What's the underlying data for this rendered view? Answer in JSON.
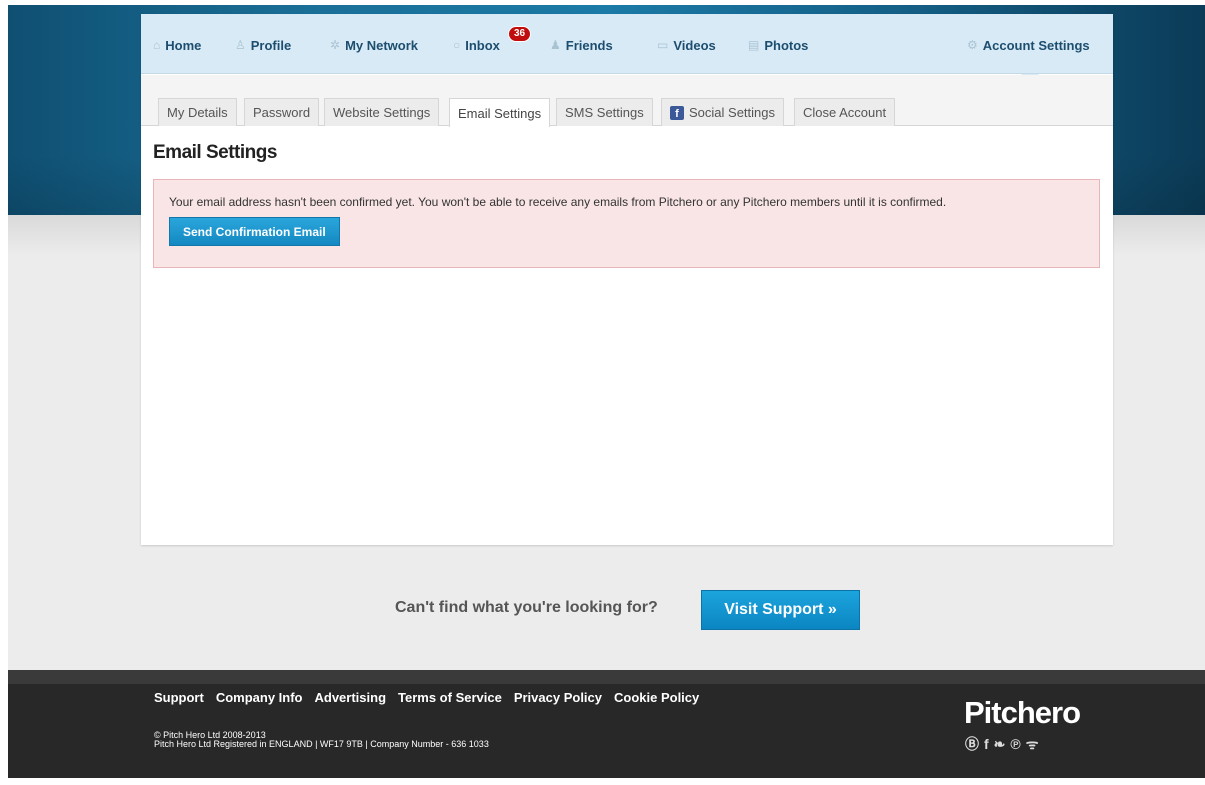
{
  "nav": {
    "items": [
      {
        "label": "Home",
        "icon": "home-icon",
        "glyph": "⌂"
      },
      {
        "label": "Profile",
        "icon": "user-icon",
        "glyph": "♙"
      },
      {
        "label": "My Network",
        "icon": "network-icon",
        "glyph": "✲"
      },
      {
        "label": "Inbox",
        "icon": "message-icon",
        "glyph": "○"
      },
      {
        "label": "Friends",
        "icon": "friends-icon",
        "glyph": "♟"
      },
      {
        "label": "Videos",
        "icon": "video-icon",
        "glyph": "▭"
      },
      {
        "label": "Photos",
        "icon": "photos-icon",
        "glyph": "▤"
      },
      {
        "label": "Account Settings",
        "icon": "gear-icon",
        "glyph": "⚙"
      }
    ],
    "inbox_count": "36"
  },
  "tabs": [
    "My Details",
    "Password",
    "Website Settings",
    "Email Settings",
    "SMS Settings",
    "Social Settings",
    "Close Account"
  ],
  "active_tab": "Email Settings",
  "page": {
    "title": "Email Settings",
    "alert_text": "Your email address hasn't been confirmed yet. You won't be able to receive any emails from Pitchero or any Pitchero members until it is confirmed.",
    "confirm_button": "Send Confirmation Email"
  },
  "support": {
    "question": "Can't find what you're looking for?",
    "button": "Visit Support »"
  },
  "footer": {
    "links": [
      "Support",
      "Company Info",
      "Advertising",
      "Terms of Service",
      "Privacy Policy",
      "Cookie Policy"
    ],
    "copyright": "© Pitch Hero Ltd 2008-2013",
    "registered": "Pitch Hero Ltd Registered in ENGLAND | WF17 9TB | Company Number - 636 1033",
    "logo": "Pitchero",
    "social": [
      "blogger-icon",
      "facebook-icon",
      "twitter-icon",
      "pinterest-icon",
      "rss-icon"
    ]
  },
  "colors": {
    "header_blue": "#1b7aa6",
    "nav_bg": "#d8eaf5",
    "alert_bg": "#f9e5e6",
    "button_blue": "#1488c2",
    "footer_bg": "#282828",
    "badge_red": "#c00d0d"
  }
}
